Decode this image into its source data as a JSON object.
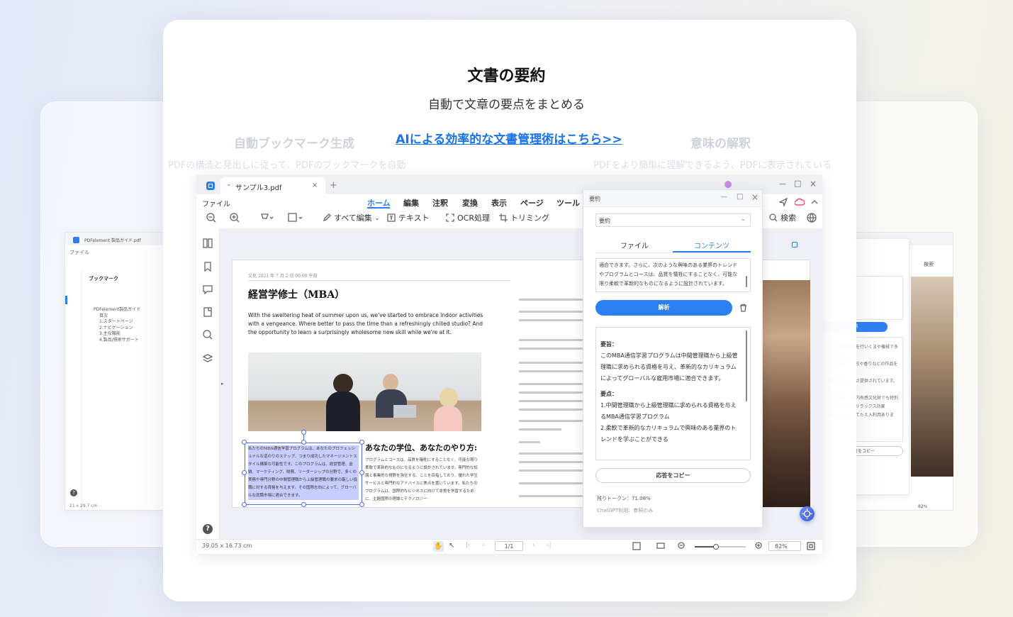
{
  "hero": {
    "title": "文書の要約",
    "subtitle": "自動で文章の要点をまとめる",
    "link_text": "AIによる効率的な文書管理術はこちら>>"
  },
  "side_features": {
    "left_title": "自動ブックマーク生成",
    "left_desc": "PDFの構造と見出しに従って、PDFのブックマークを自動",
    "right_title": "意味の解釈",
    "right_desc": "PDFをより簡単に理解できるよう、PDFに表示されている"
  },
  "app": {
    "tab_title": "サンプル3.pdf",
    "file_menu": "ファイル",
    "menus": [
      "ホーム",
      "編集",
      "注釈",
      "変換",
      "表示",
      "ページ",
      "ツール"
    ],
    "toolbar": {
      "edit_all": "すべて編集",
      "text": "テキスト",
      "ocr": "OCR処理",
      "trim": "トリミング",
      "search": "検索"
    },
    "status": {
      "dimensions": "39.05 x 16.73 cm",
      "page": "1/1",
      "zoom": "82%"
    }
  },
  "document": {
    "date": "文化 2021 年 7 月 2 日 00:00 午前",
    "title": "経営学修士（MBA）",
    "intro": "With the sweltering heat of summer upon us, we've started to embrace indoor activities with a vengeance. Where better to pass the time than a refreshingly chilled studio? And the opportunity to learn a surprisingly wholesome new skill while we're at it.",
    "subheading": "あなたの学位、あなたのやり方:",
    "highlight_text": "私たちのMBA通信学習プログラムは、あなたのプロフェッショナルな道のりのステップ、つまり成功したマネージメントスタイル構築な可能性です。このプログラムは、経営管理、金融、マーケティング、財務、リーダーシップの分野で、多くの実務や専門分野の中間管理職から上級管理職の要求の厳しい役職に対する資格を与えます。その国際志向によって、グローバルな就職市場に適合できます。",
    "body_text": "プログラムとコースは、品質を犠牲にすることなく、可能な限り柔軟で革新的なものになるように設計されています。専門的な知識と事業的な視野を強化する、ことを目指しており、優れた学生サービスと専門的なアドバイスに焦点を置いています。私たちのプログラムは、国際的なビジネスに向けて本質を学習するために、主題国際の理論とテクノロジー"
  },
  "summary_panel": {
    "title": "要約",
    "dropdown": "要約",
    "tabs": [
      "ファイル",
      "コンテンツ"
    ],
    "input_text": "適合できます。さらに、次のような興味のある業界のトレンドやプログラムとコースは、品質を犠牲にすることなく、可能な限り柔軟で革新的なものになるように設計されています。",
    "analyze_button": "解析",
    "result_heading1": "要旨：",
    "result_body1": "このMBA通信学習プログラムは中間管理職から上級管理職に求められる資格を与え、革新的なカリキュラムによってグローバルな雇用市場に適合できます。",
    "result_heading2": "要点：",
    "result_point1": "1.中間管理職から上級管理職に求められる資格を与えるMBA通信学習プログラム",
    "result_point2": "2.柔軟で革新的なカリキュラムで興味のある業界のトレンドを学ぶことができる",
    "copy_button": "応答をコピー",
    "tokens": "残りトークン：71.08%",
    "footer": "ChatGPT利用、参照のみ"
  },
  "left_window": {
    "tab_title": "PDFelement 製品ガイド.pdf",
    "file_menu": "ファイル",
    "panel_title": "ブックマーク",
    "bookmarks": [
      "PDFelement製品ガイド",
      "目次",
      "1.スタートページ",
      "2.ナビゲーション",
      "3.主な機能",
      "4.製品/技術サポート"
    ],
    "status": "21 x 29.7 cm"
  },
  "right_window": {
    "search": "検索",
    "analyze_button": "解析",
    "copy_button": "応答をコピー",
    "zoom": "82%",
    "text_lines": [
      "さや上級管理職を行いくまや機械で多様で非実を",
      "工芸体験です。形や香りなどの作品を作",
      "体験作品としてさ提供されています。伝",
      "いた体験し、国内有感文化財でも特別",
      "として、伝統のリラックス効果",
      "お楽しんをとしてたえ入利用あります。"
    ]
  },
  "colors": {
    "accent": "#2d7ef0",
    "link": "#1a73e8",
    "highlight": "#c8ccff"
  }
}
